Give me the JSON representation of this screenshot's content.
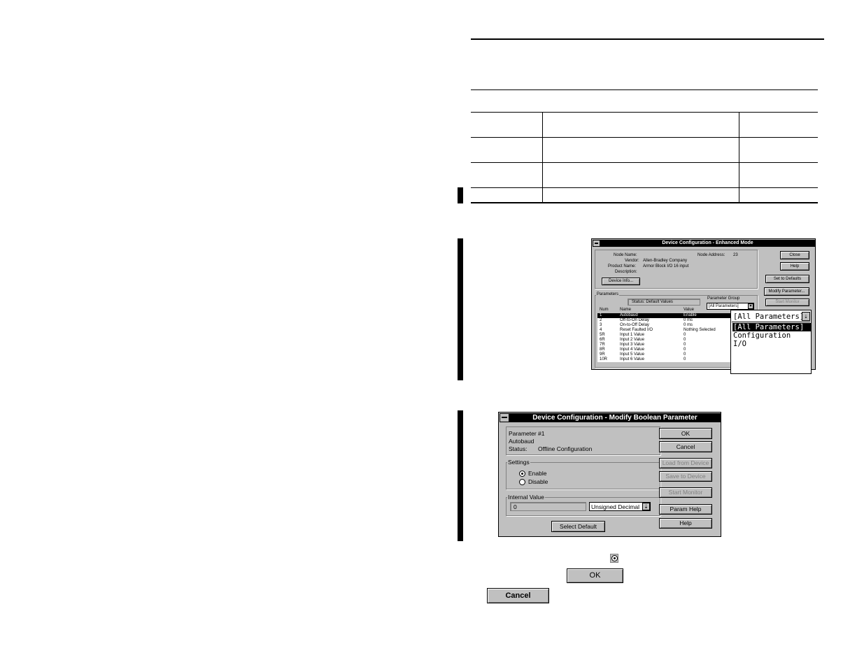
{
  "win1": {
    "title": "Device Configuration - Enhanced Mode",
    "node_name_label": "Node Name:",
    "node_address_label": "Node Address:",
    "node_address_value": "23",
    "vendor_label": "Vendor:",
    "vendor_value": "Allen-Bradley Company",
    "product_name_label": "Product Name:",
    "product_name_value": "Armor Block I/O  16 input",
    "description_label": "Description:",
    "device_info_button": "Device Info...",
    "close_button": "Close",
    "help_button": "Help",
    "set_defaults_button": "Set to Defaults",
    "modify_parameter_button": "Modify Parameter...",
    "start_monitor_button": "Start Monitor",
    "parameters_label": "Parameters",
    "status_text": "Status:  Default Values",
    "parameter_group_label": "Parameter Group",
    "parameter_group_value": "[All Parameters]",
    "columns": {
      "num": "Num",
      "name": "Name",
      "value": "Value"
    },
    "rows": [
      {
        "num": "1",
        "name": "Autobaud",
        "value": "Enable"
      },
      {
        "num": "2",
        "name": "Off-to-On Delay",
        "value": "0 ms"
      },
      {
        "num": "3",
        "name": "On-to-Off Delay",
        "value": "0 ms"
      },
      {
        "num": "4",
        "name": "Reset Faulted I/O",
        "value": "Nothing Selected"
      },
      {
        "num": "5R",
        "name": "Input 1 Value",
        "value": "0"
      },
      {
        "num": "6R",
        "name": "Input 2 Value",
        "value": "0"
      },
      {
        "num": "7R",
        "name": "Input 3 Value",
        "value": "0"
      },
      {
        "num": "8R",
        "name": "Input 4 Value",
        "value": "0"
      },
      {
        "num": "9R",
        "name": "Input 5 Value",
        "value": "0"
      },
      {
        "num": "10R",
        "name": "Input 6 Value",
        "value": "0"
      }
    ]
  },
  "dropdown_zoom": {
    "selected": "[All Parameters]",
    "options": [
      "[All Parameters]",
      "Configuration",
      "I/O"
    ]
  },
  "win2": {
    "title": "Device Configuration - Modify Boolean Parameter",
    "param_number": "Parameter #1",
    "param_name": "Autobaud",
    "status_label": "Status:",
    "status_value": "Offline Configuration",
    "settings_label": "Settings",
    "enable_label": "Enable",
    "disable_label": "Disable",
    "internal_value_label": "Internal Value",
    "internal_value": "0",
    "format_value": "Unsigned Decimal",
    "select_default_button": "Select Default",
    "ok_button": "OK",
    "cancel_button": "Cancel",
    "load_from_device_button": "Load from Device",
    "save_to_device_button": "Save to Device",
    "start_monitor_button": "Start Monitor",
    "param_help_button": "Param Help",
    "help_button": "Help"
  },
  "inline_icons": {
    "ok_label": "OK",
    "cancel_label": "Cancel"
  }
}
